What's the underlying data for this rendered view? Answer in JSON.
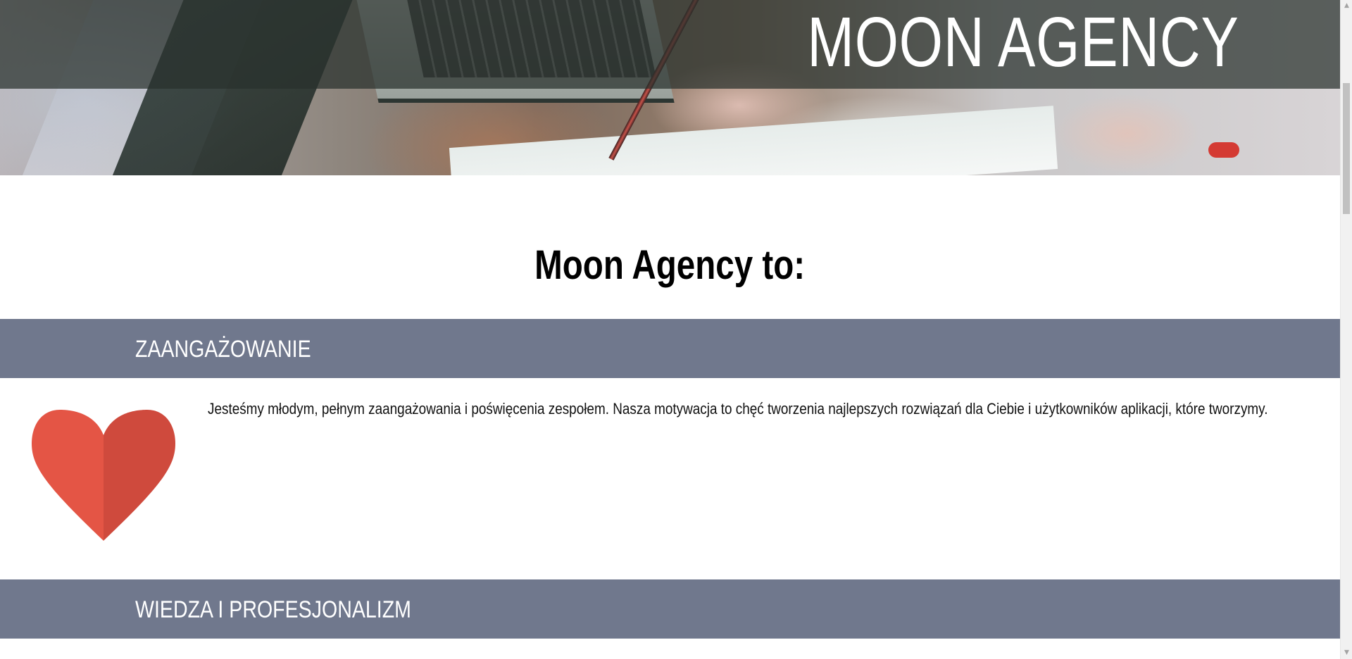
{
  "hero": {
    "title": "MOON AGENCY"
  },
  "main": {
    "heading": "Moon Agency to:"
  },
  "features": [
    {
      "title": "ZAANGAŻOWANIE",
      "icon": "heart-icon",
      "description": "Jesteśmy młodym, pełnym zaangażowania i poświęcenia zespołem. Nasza motywacja to chęć tworzenia najlepszych rozwiązań dla Ciebie i użytkowników aplikacji, które tworzymy."
    },
    {
      "title": "WIEDZA I PROFESJONALIZM"
    }
  ],
  "colors": {
    "feature_bar": "#70788d",
    "heart_left": "#e45545",
    "heart_right": "#cf4a3d"
  }
}
